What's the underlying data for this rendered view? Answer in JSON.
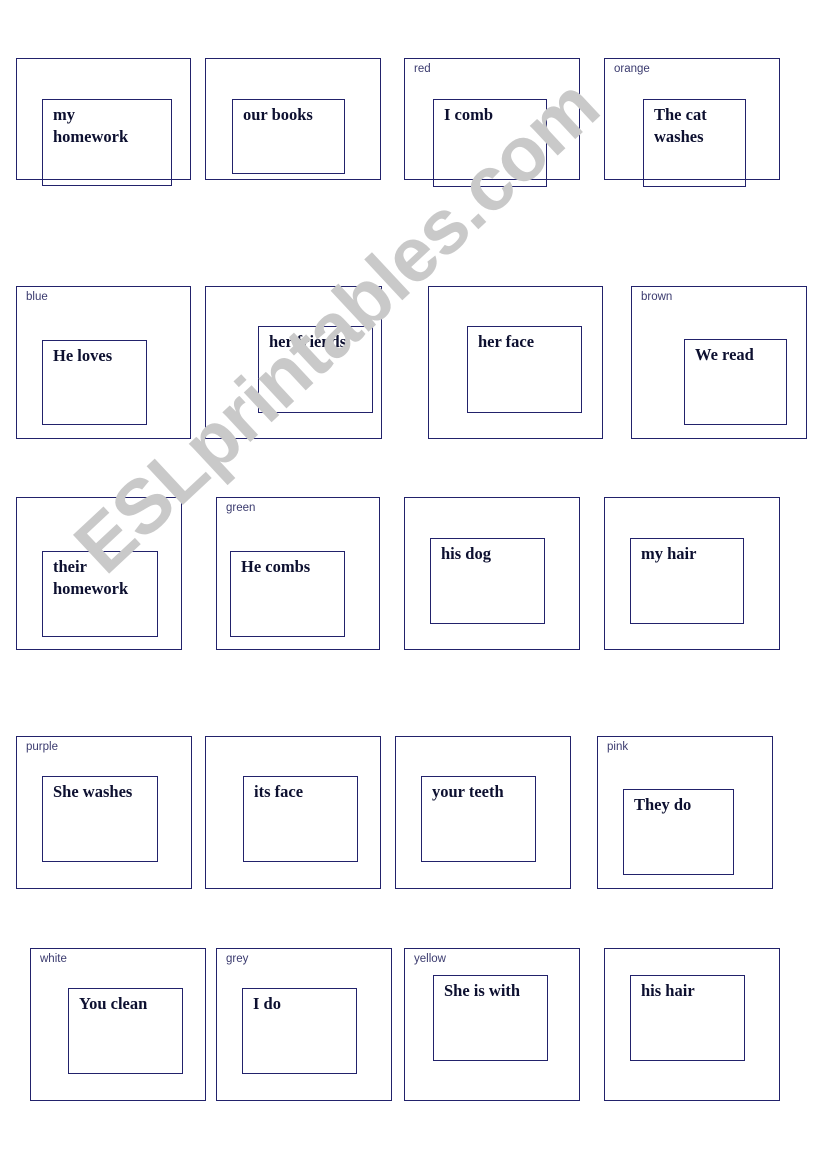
{
  "page": {
    "watermark_text": "ESLprintables.com",
    "watermark_color": "#c9c9c9",
    "border_color": "#22226b",
    "text_color": "#0d1030",
    "background_color": "#ffffff"
  },
  "cards": [
    {
      "color_label": "",
      "phrase": "my\nhomework",
      "row": 1,
      "col": 1
    },
    {
      "color_label": "",
      "phrase": "our books",
      "row": 1,
      "col": 2
    },
    {
      "color_label": "red",
      "phrase": "I comb",
      "row": 1,
      "col": 3
    },
    {
      "color_label": "orange",
      "phrase": "The cat\nwashes",
      "row": 1,
      "col": 4
    },
    {
      "color_label": "blue",
      "phrase": "He  loves",
      "row": 2,
      "col": 1
    },
    {
      "color_label": "",
      "phrase": "her friends",
      "row": 2,
      "col": 2
    },
    {
      "color_label": "",
      "phrase": "her face",
      "row": 2,
      "col": 3
    },
    {
      "color_label": "brown",
      "phrase": "We read",
      "row": 2,
      "col": 4
    },
    {
      "color_label": "",
      "phrase": "their\nhomework",
      "row": 3,
      "col": 1
    },
    {
      "color_label": "green",
      "phrase": "He combs",
      "row": 3,
      "col": 2
    },
    {
      "color_label": "",
      "phrase": "his dog",
      "row": 3,
      "col": 3
    },
    {
      "color_label": "",
      "phrase": "my hair",
      "row": 3,
      "col": 4
    },
    {
      "color_label": "purple",
      "phrase": "She washes",
      "row": 4,
      "col": 1
    },
    {
      "color_label": "",
      "phrase": "its face",
      "row": 4,
      "col": 2
    },
    {
      "color_label": "",
      "phrase": "your teeth",
      "row": 4,
      "col": 3
    },
    {
      "color_label": "pink",
      "phrase": "They do",
      "row": 4,
      "col": 4
    },
    {
      "color_label": "white",
      "phrase": "You clean",
      "row": 5,
      "col": 1
    },
    {
      "color_label": "grey",
      "phrase": "I do",
      "row": 5,
      "col": 2
    },
    {
      "color_label": "yellow",
      "phrase": "She is with",
      "row": 5,
      "col": 3
    },
    {
      "color_label": "",
      "phrase": "his hair",
      "row": 5,
      "col": 4
    }
  ]
}
